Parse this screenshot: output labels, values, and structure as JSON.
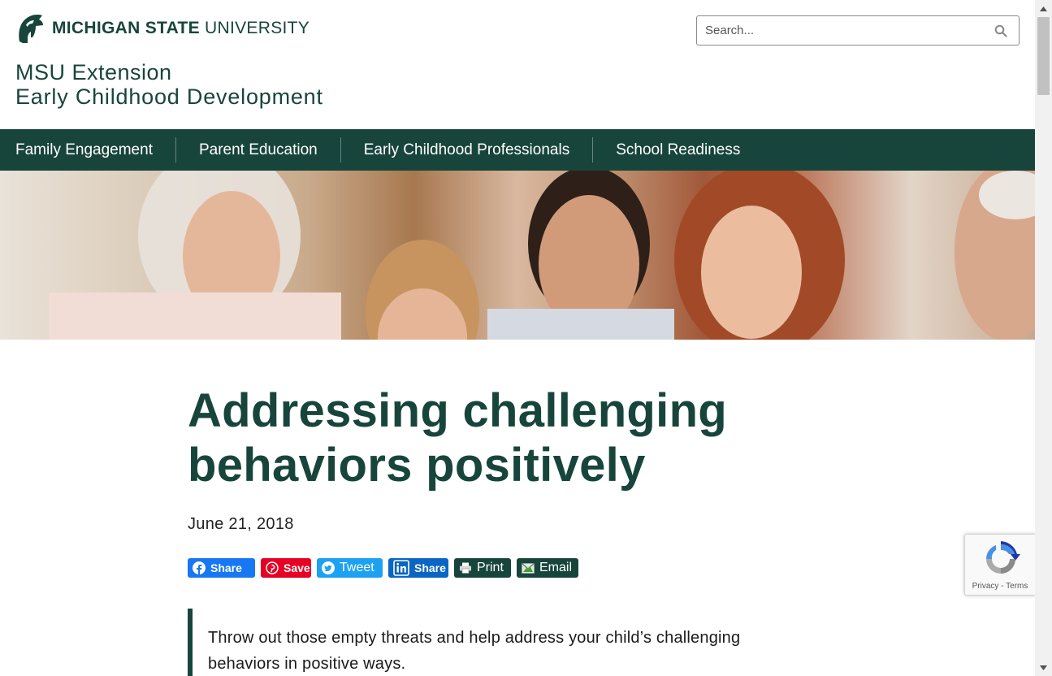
{
  "header": {
    "logo_bold": "MICHIGAN STATE",
    "logo_light": " UNIVERSITY",
    "search_placeholder": "Search...",
    "site_title_line1": "MSU Extension",
    "site_title_line2": "Early Childhood Development"
  },
  "nav": {
    "items": [
      {
        "label": "Family Engagement"
      },
      {
        "label": "Parent Education"
      },
      {
        "label": "Early Childhood Professionals"
      },
      {
        "label": "School Readiness"
      }
    ]
  },
  "article": {
    "headline": "Addressing challenging behaviors positively",
    "date": "June 21, 2018",
    "summary": "Throw out those empty threats and help address your child’s challenging behaviors in positive ways."
  },
  "share": {
    "facebook": "Share",
    "pinterest": "Save",
    "twitter": "Tweet",
    "linkedin": "Share",
    "print": "Print",
    "email": "Email"
  },
  "recaptcha": {
    "terms": "Privacy - Terms"
  },
  "colors": {
    "brand_green": "#18453b",
    "facebook": "#1877f2",
    "pinterest": "#e60023",
    "twitter": "#1da1f2",
    "linkedin": "#0a66c2"
  },
  "icons": [
    "spartan-helmet-icon",
    "search-icon",
    "facebook-icon",
    "pinterest-icon",
    "twitter-icon",
    "linkedin-icon",
    "print-icon",
    "email-icon",
    "recaptcha-icon"
  ]
}
